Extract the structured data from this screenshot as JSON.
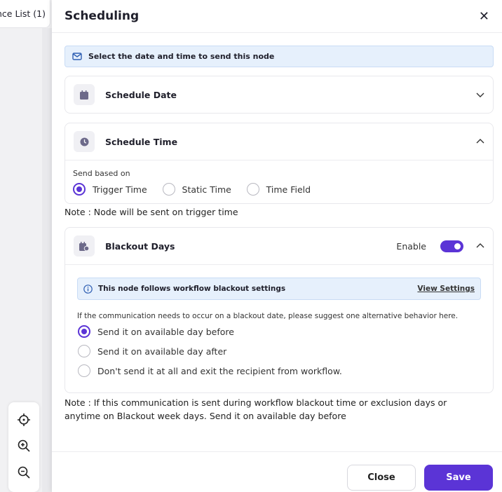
{
  "background": {
    "tab_label": "ence List (1)"
  },
  "dialog": {
    "title": "Scheduling",
    "info_text": "Select the date and time to send this node",
    "schedule_date": {
      "title": "Schedule Date",
      "expanded": false
    },
    "schedule_time": {
      "title": "Schedule Time",
      "expanded": true,
      "send_based_on_label": "Send based on",
      "options": [
        {
          "label": "Trigger Time",
          "selected": true
        },
        {
          "label": "Static Time",
          "selected": false
        },
        {
          "label": "Time Field",
          "selected": false
        }
      ]
    },
    "time_note": "Note : Node will be sent on trigger time",
    "blackout": {
      "title": "Blackout Days",
      "enable_label": "Enable",
      "enabled": true,
      "info_text": "This node follows workflow blackout settings",
      "view_settings": "View Settings",
      "question": "If the communication needs to occur on a blackout date, please suggest one alternative behavior here.",
      "options": [
        {
          "label": "Send it on available day before",
          "selected": true
        },
        {
          "label": "Send it on available day after",
          "selected": false
        },
        {
          "label": "Don't send it at all and exit the recipient from workflow.",
          "selected": false
        }
      ]
    },
    "blackout_note": "Note : If this communication is sent during workflow blackout time or exclusion days or anytime on Blackout week days. Send it on available day before",
    "close_label": "Close",
    "save_label": "Save"
  },
  "colors": {
    "accent": "#5b34d6",
    "info_bg": "#e6f0fc"
  }
}
